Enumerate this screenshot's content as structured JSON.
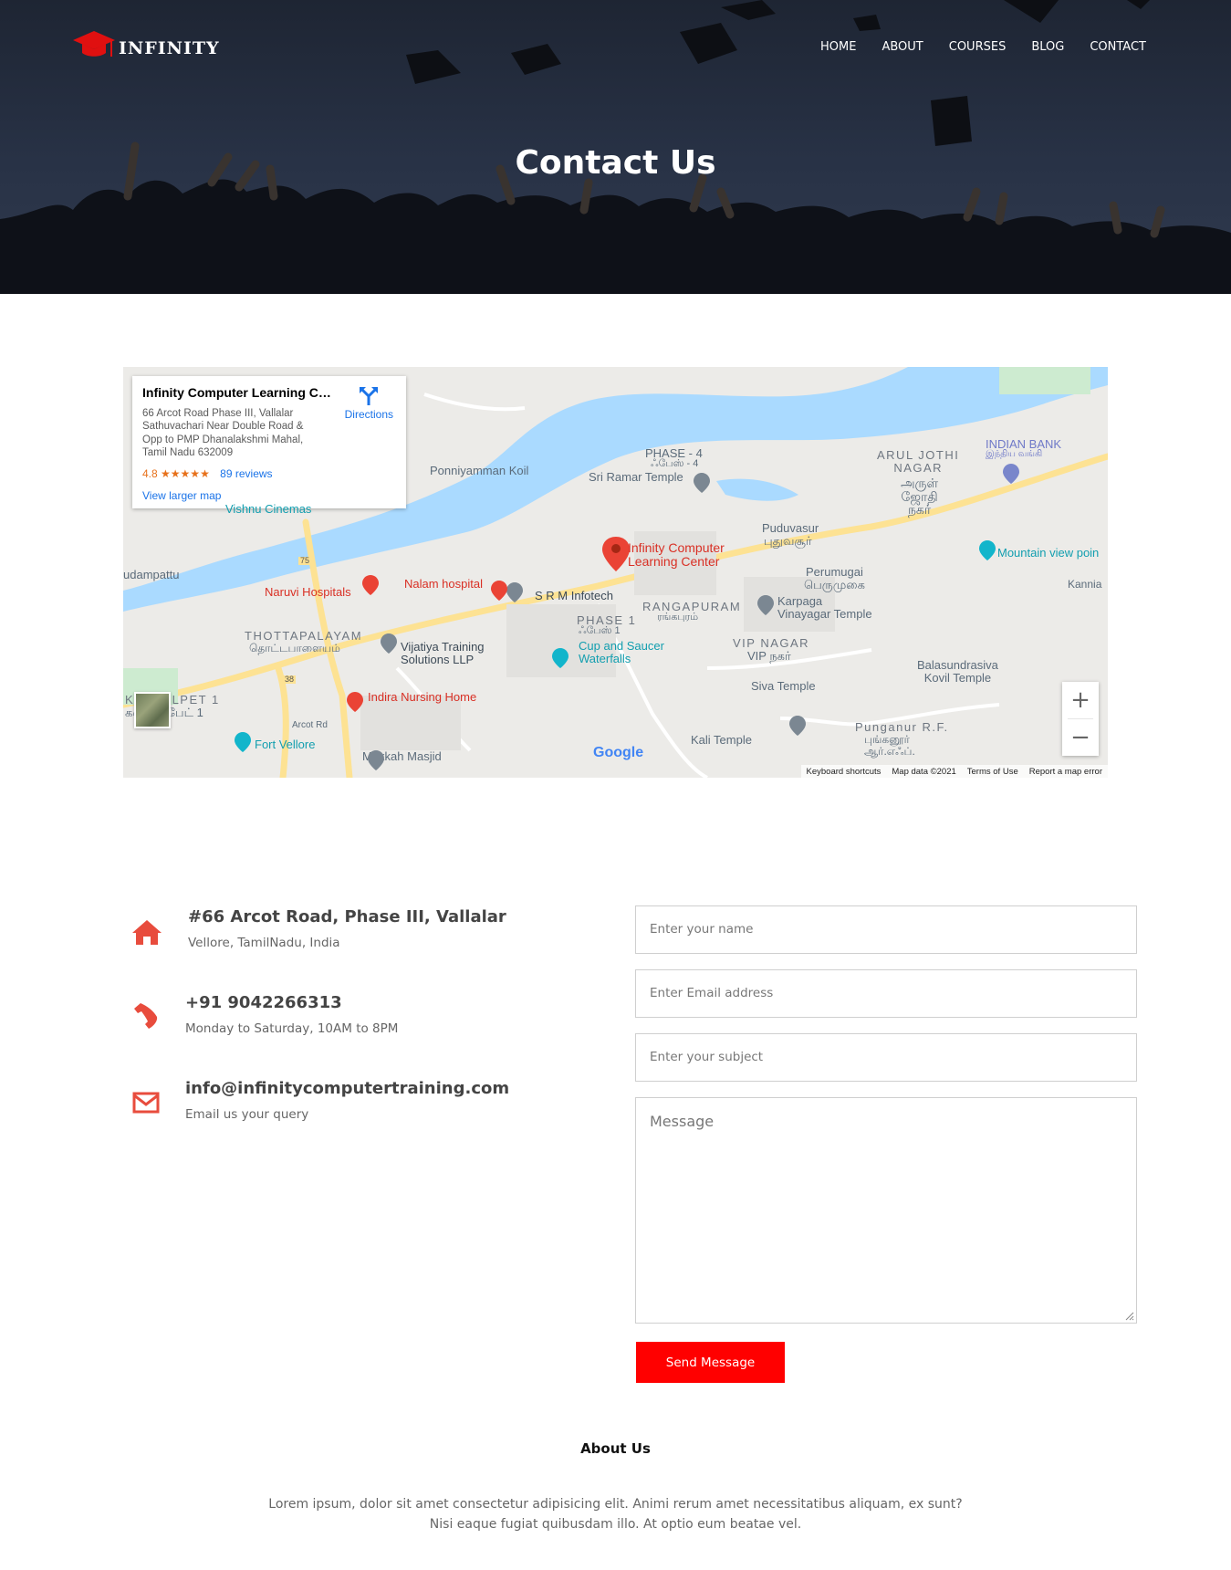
{
  "header": {
    "brand": "INFINITY",
    "nav": [
      "HOME",
      "ABOUT",
      "COURSES",
      "BLOG",
      "CONTACT"
    ],
    "page_title": "Contact Us"
  },
  "map": {
    "place_name": "Infinity Computer Learning Ce...",
    "address": "66 Arcot Road Phase III, Vallalar\nSathuvachari Near Double Road &\nOpp to PMP Dhanalakshmi Mahal,\nTamil Nadu 632009",
    "rating": "4.8",
    "stars": "★★★★★",
    "reviews": "89 reviews",
    "larger_map": "View larger map",
    "directions": "Directions",
    "marker_label": "Infinity Computer\nLearning Center",
    "labels": {
      "phase4": "PHASE - 4",
      "phase4_ta": "ஃபேஸ் - 4",
      "sri_ramar": "Sri Ramar Temple",
      "ponniyamman": "Ponniyamman Koil",
      "arul_jothi": "ARUL JOTHI\nNAGAR",
      "arul_jothi_ta": "அருள்\nஜோதி\nநகர்",
      "indian_bank": "INDIAN BANK",
      "indian_bank_ta": "இந்திய வங்கி",
      "puduvasur": "Puduvasur",
      "puduvasur_ta": "புதுவசூர்",
      "mountain_view": "Mountain view poin",
      "perumugai": "Perumugai",
      "perumugai_ta": "பெருமுகை",
      "kannia": "Kannia",
      "vishnu_cinemas": "Vishnu Cinemas",
      "naruvi": "Naruvi Hospitals",
      "nalam": "Nalam hospital",
      "srm": "S R M Infotech",
      "rangapuram": "RANGAPURAM",
      "rangapuram_ta": "ரங்கபுரம்",
      "karpaga": "Karpaga\nVinayagar Temple",
      "thottapalayam": "THOTTAPALAYAM",
      "thottapalayam_ta": "தொட்டபாளையம்",
      "vijatiya": "Vijatiya Training\nSolutions LLP",
      "phase1": "PHASE 1",
      "phase1_ta": "ஃபேஸ் 1",
      "cup_saucer": "Cup and Saucer\nWaterfalls",
      "vip_nagar": "VIP NAGAR",
      "vip_nagar_ta": "VIP நகர்",
      "balasundrasiva": "Balasundrasiva\nKovil Temple",
      "kansalpet": "KANSALPET 1",
      "kansalpet_ta": "கன்சால்பேட் 1",
      "indira": "Indira Nursing Home",
      "siva_temple": "Siva Temple",
      "punganur": "Punganur R.F.",
      "punganur_ta": "புங்கனூர்\nஆர்.எஃப்.",
      "fort_vellore": "Fort Vellore",
      "makkah": "Makkah Masjid",
      "kali": "Kali Temple",
      "dampattu": "udampattu",
      "arcot_rd": "Arcot Rd",
      "road_75": "75",
      "road_38": "38",
      "google": "Google"
    },
    "footer": [
      "Keyboard shortcuts",
      "Map data ©2021",
      "Terms of Use",
      "Report a map error"
    ],
    "zoom_in": "+",
    "zoom_out": "−"
  },
  "contact": {
    "address_title": "#66 Arcot Road, Phase III, Vallalar",
    "address_sub": "Vellore, TamilNadu, India",
    "phone_title": "+91 9042266313",
    "phone_sub": "Monday to Saturday, 10AM to 8PM",
    "email_title": "info@infinitycomputertraining.com",
    "email_sub": "Email us your query"
  },
  "form": {
    "name_placeholder": "Enter your name",
    "email_placeholder": "Enter Email address",
    "subject_placeholder": "Enter your subject",
    "message_placeholder": "Message",
    "send_label": "Send Message"
  },
  "about": {
    "title": "About Us",
    "text_line1": "Lorem ipsum, dolor sit amet consectetur adipisicing elit. Animi rerum amet necessitatibus aliquam, ex sunt?",
    "text_line2": "Nisi eaque fugiat quibusdam illo. At optio eum beatae vel."
  },
  "colors": {
    "accent": "#ff0000",
    "map_water": "#aadaff",
    "map_road": "#fde293"
  }
}
